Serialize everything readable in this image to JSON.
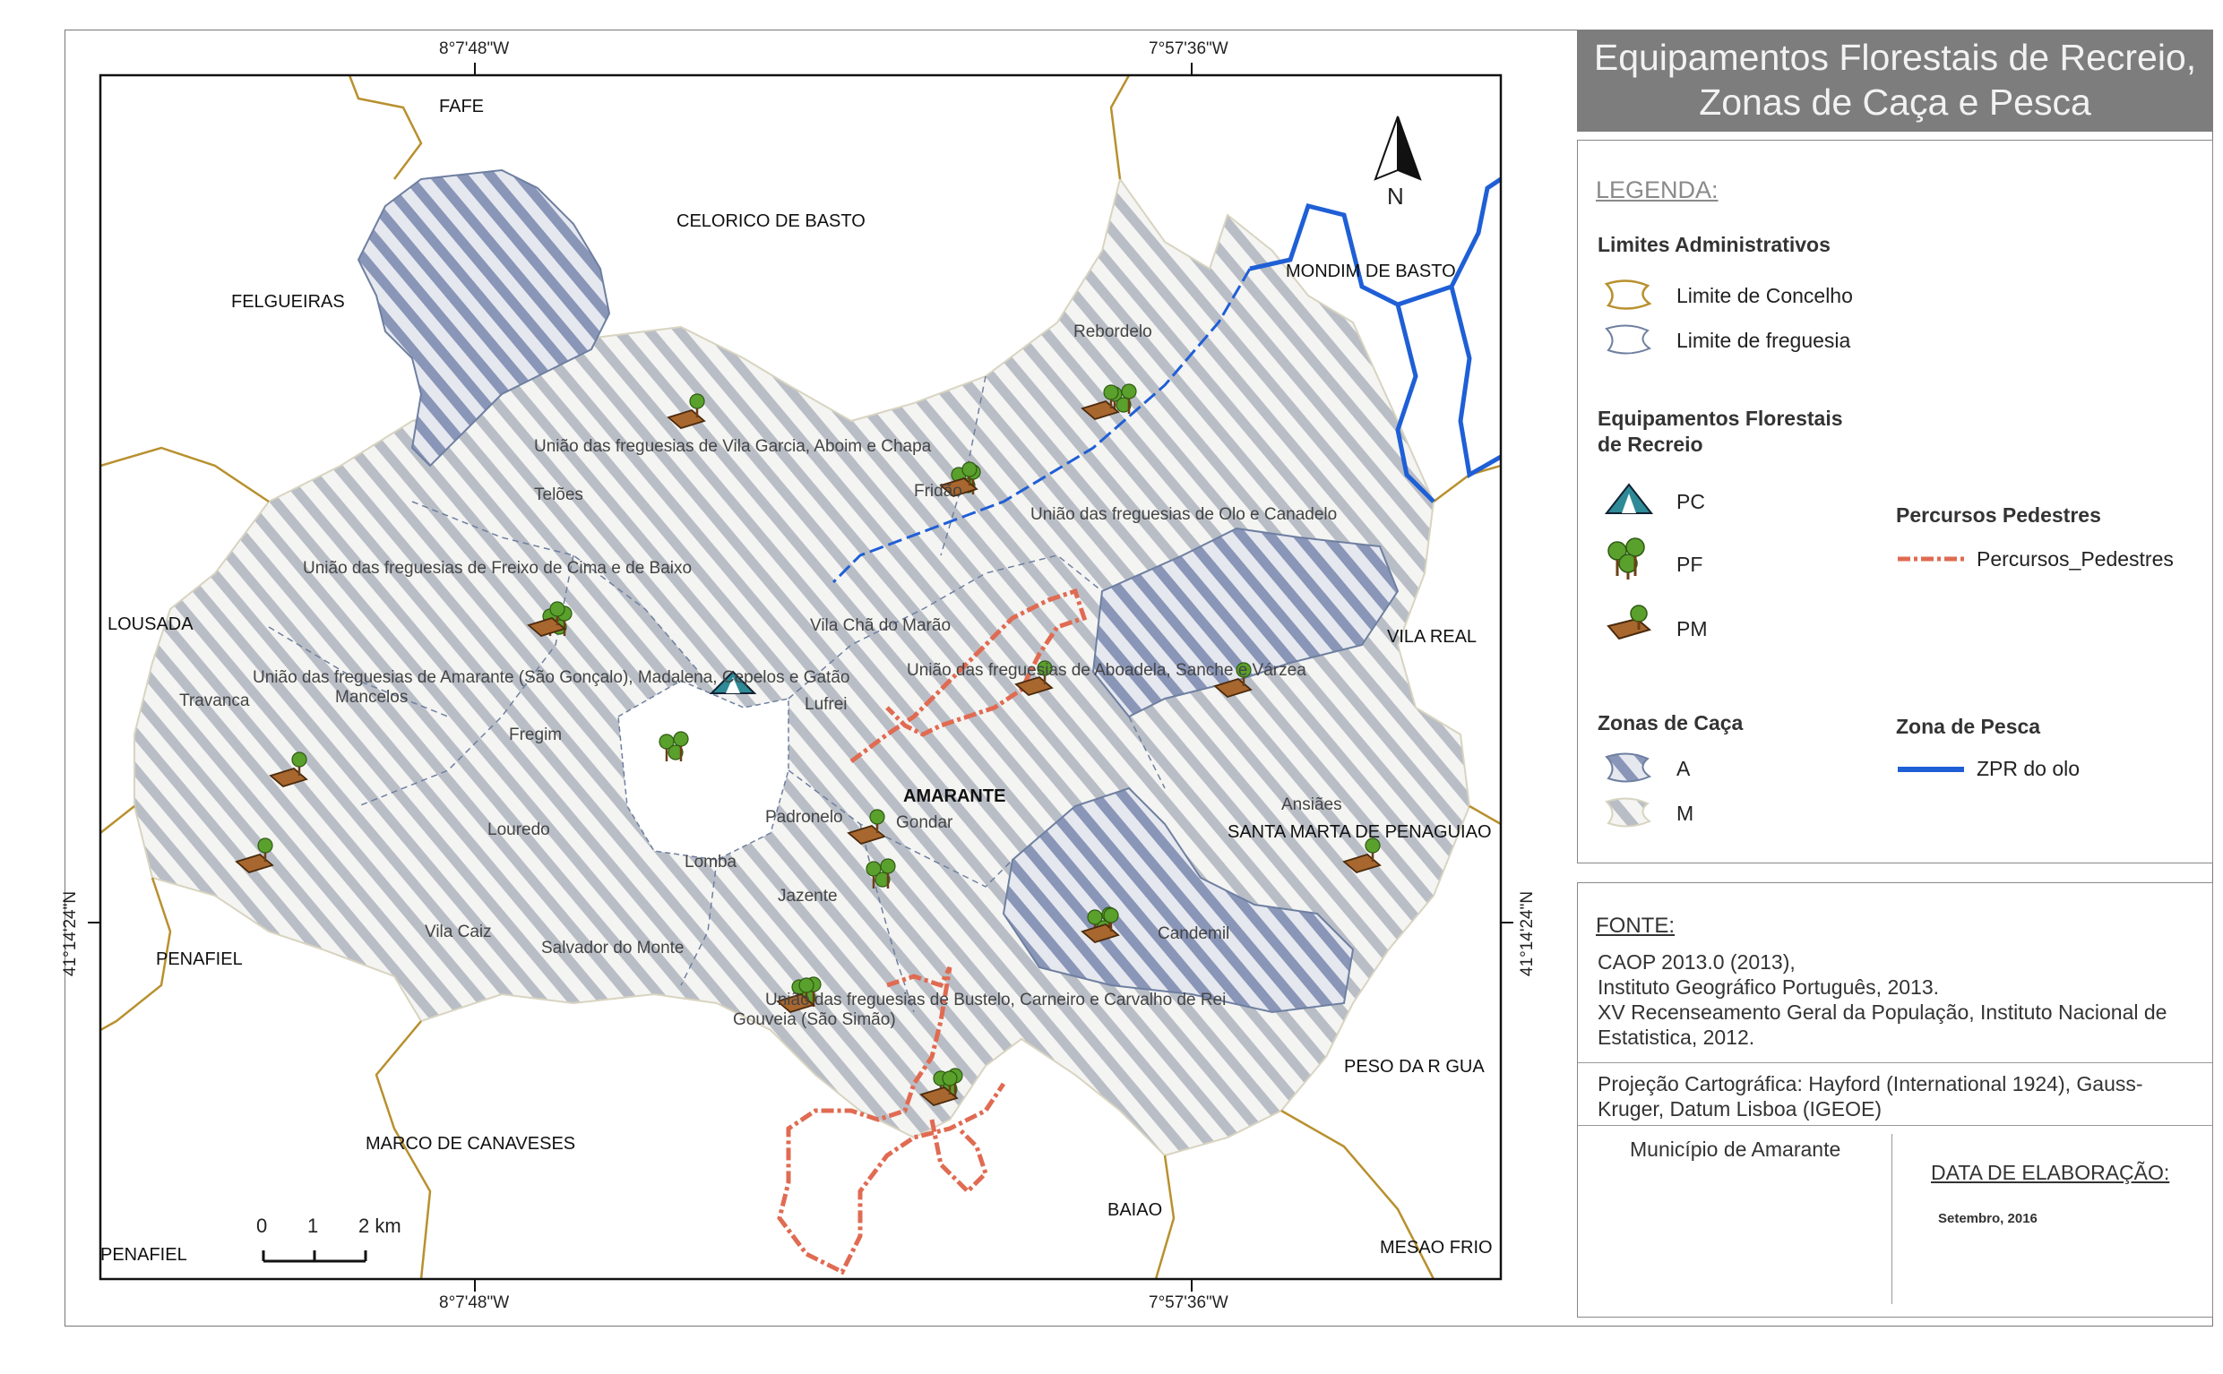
{
  "title": {
    "line1": "Equipamentos Florestais de Recreio,",
    "line2": "Zonas de Caça e Pesca"
  },
  "map": {
    "coord_top_left": "8°7'48\"W",
    "coord_top_right": "7°57'36\"W",
    "coord_bottom_left": "8°7'48\"W",
    "coord_bottom_right": "7°57'36\"W",
    "coord_left": "41°14'24\"N",
    "coord_right": "41°14'24\"N",
    "north_label": "N",
    "scale_labels": [
      "0",
      "1",
      "2 km"
    ],
    "concelhos": [
      "FAFE",
      "CELORICO DE BASTO",
      "FELGUEIRAS",
      "MONDIM DE BASTO",
      "LOUSADA",
      "VILA REAL",
      "SANTA MARTA DE PENAGUIAO",
      "PENAFIEL",
      "PESO DA R  GUA",
      "MARCO DE CANAVESES",
      "BAIAO",
      "PENAFIEL",
      "MESAO FRIO",
      "AMARANTE"
    ],
    "freguesias": [
      "Rebordelo",
      "União das freguesias de Vila Garcia, Aboim e Chapa",
      "Telões",
      "Fridão",
      "União das freguesias de Olo e Canadelo",
      "União das freguesias de Freixo de Cima e de Baixo",
      "Vila Chã do Marão",
      "União das freguesias de Amarante (São Gonçalo), Madalena, Cepelos e Gatão",
      "União das freguesias de Aboadela, Sanche e Várzea",
      "Travanca",
      "Mancelos",
      "Lufrei",
      "Fregim",
      "Ansiães",
      "Padronelo",
      "Gondar",
      "Louredo",
      "Lomba",
      "Jazente",
      "Candemil",
      "Vila Caiz",
      "Salvador do Monte",
      "União das freguesias de Bustelo, Carneiro e Carvalho de Rei",
      "Gouveia (São Simão)"
    ]
  },
  "legend": {
    "heading": "LEGENDA:",
    "admin_title": "Limites Administrativos",
    "concelho_label": "Limite de Concelho",
    "freguesia_label": "Limite de freguesia",
    "equip_title_1": "Equipamentos Florestais",
    "equip_title_2": "de Recreio",
    "pc_label": "PC",
    "pf_label": "PF",
    "pm_label": "PM",
    "percursos_title": "Percursos Pedestres",
    "percursos_label": "Percursos_Pedestres",
    "caca_title": "Zonas de Caça",
    "caca_a": "A",
    "caca_m": "M",
    "pesca_title": "Zona de Pesca",
    "pesca_label": "ZPR do olo",
    "colors": {
      "concelho": "#b8902e",
      "freguesia": "#6e7fa0",
      "zona_a": "#8a96b8",
      "zona_m": "#b9bec6",
      "percursos": "#e06b52",
      "pesca": "#1f5fd6"
    }
  },
  "sources": {
    "heading": "FONTE:",
    "line1": "CAOP 2013.0 (2013),",
    "line2": "Instituto Geográfico Português, 2013.",
    "line3": "XV Recenseamento Geral da População, Instituto Nacional de Estatistica, 2012.",
    "projection": "Projeção Cartográfica: Hayford (International 1924), Gauss-Kruger, Datum Lisboa (IGEOE)",
    "author": "Município de Amarante",
    "date_label": "DATA DE ELABORAÇÃO:",
    "date_value": "Setembro, 2016"
  }
}
